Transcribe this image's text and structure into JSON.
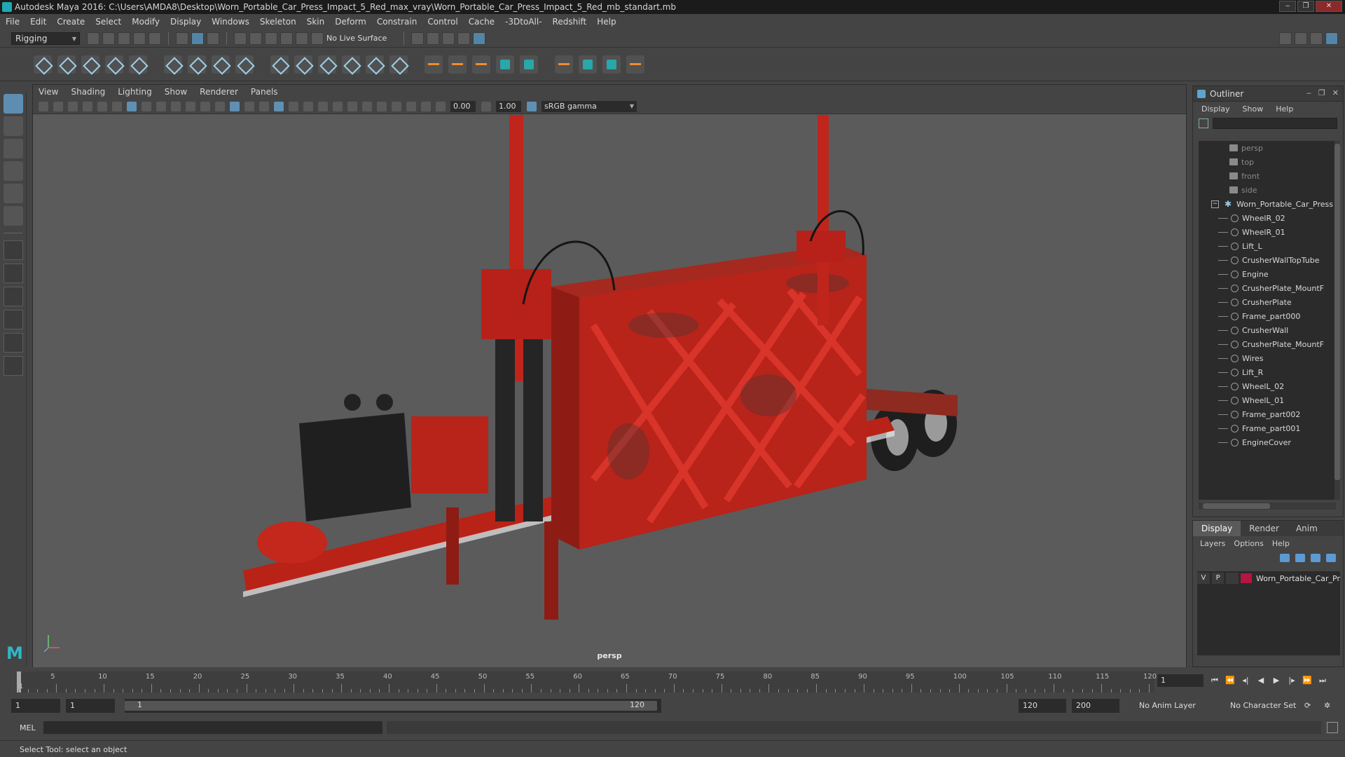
{
  "window": {
    "title": "Autodesk Maya 2016: C:\\Users\\AMDA8\\Desktop\\Worn_Portable_Car_Press_Impact_5_Red_max_vray\\Worn_Portable_Car_Press_Impact_5_Red_mb_standart.mb"
  },
  "menubar": [
    "File",
    "Edit",
    "Create",
    "Select",
    "Modify",
    "Display",
    "Windows",
    "Skeleton",
    "Skin",
    "Deform",
    "Constrain",
    "Control",
    "Cache",
    "-3DtoAll-",
    "Redshift",
    "Help"
  ],
  "statusline": {
    "mode": "Rigging",
    "live_surface": "No Live Surface"
  },
  "viewport": {
    "menu": [
      "View",
      "Shading",
      "Lighting",
      "Show",
      "Renderer",
      "Panels"
    ],
    "exposure": "0.00",
    "gamma": "1.00",
    "color_space": "sRGB gamma",
    "camera": "persp"
  },
  "outliner": {
    "title": "Outliner",
    "menu": [
      "Display",
      "Show",
      "Help"
    ],
    "cameras": [
      "persp",
      "top",
      "front",
      "side"
    ],
    "group": "Worn_Portable_Car_Press",
    "children": [
      "WheelR_02",
      "WheelR_01",
      "Lift_L",
      "CrusherWallTopTube",
      "Engine",
      "CrusherPlate_MountF",
      "CrusherPlate",
      "Frame_part000",
      "CrusherWall",
      "CrusherPlate_MountF",
      "Wires",
      "Lift_R",
      "WheelL_02",
      "WheelL_01",
      "Frame_part002",
      "Frame_part001",
      "EngineCover"
    ]
  },
  "layers": {
    "tabs": [
      "Display",
      "Render",
      "Anim"
    ],
    "menu": [
      "Layers",
      "Options",
      "Help"
    ],
    "visible_flag": "V",
    "playback_flag": "P",
    "layer_name": "Worn_Portable_Car_Pr",
    "layer_color": "#b3163f"
  },
  "timeslider": {
    "ticks": [
      "5",
      "10",
      "15",
      "20",
      "25",
      "30",
      "35",
      "40",
      "45",
      "50",
      "55",
      "60",
      "65",
      "70",
      "75",
      "80",
      "85",
      "90",
      "95",
      "100",
      "105",
      "110",
      "115",
      "120"
    ],
    "first_frame_label": "1",
    "current_frame": "1",
    "playback_controls": [
      "⏮",
      "⏪",
      "◂|",
      "◀",
      "▶",
      "|▸",
      "⏩",
      "⏭"
    ]
  },
  "rangeslider": {
    "start": "1",
    "playback_start": "1",
    "range_start": "1",
    "range_end": "120",
    "playback_end": "120",
    "end": "200",
    "anim_layer": "No Anim Layer",
    "character_set": "No Character Set"
  },
  "cmdline": {
    "label": "MEL"
  },
  "helpline": {
    "text": "Select Tool: select an object"
  },
  "colors": {
    "accent": "#5285a6",
    "press_red": "#c8261a",
    "maya_teal": "#2fb7c6"
  }
}
